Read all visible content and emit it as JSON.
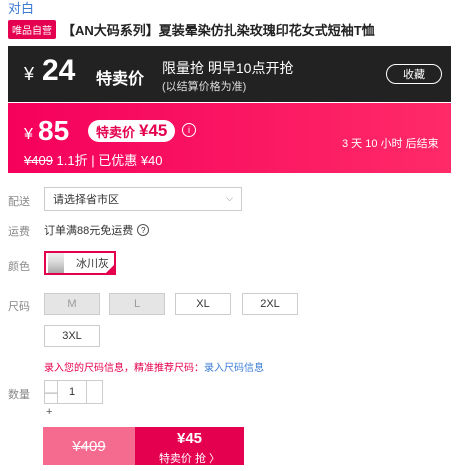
{
  "header": {
    "brand": "对白",
    "tag": "唯品自营",
    "title": "【AN大码系列】夏装晕染仿扎染玫瑰印花女式短袖T恤"
  },
  "flash_sale": {
    "currency": "¥",
    "price": "24",
    "label": "特卖价",
    "line1": "限量抢 明早10点开抢",
    "line2": "(以结算价格为准)",
    "favorite_label": "收藏"
  },
  "price": {
    "currency": "¥",
    "current": "85",
    "sale_label": "特卖价",
    "sale_amount": "¥45",
    "info_icon": "i",
    "original": "¥409",
    "discount_text": "1.1折 | 已优惠 ¥40",
    "countdown": "3 天 10 小时 后结束"
  },
  "shipping_to": {
    "label": "配送",
    "placeholder": "请选择省市区"
  },
  "freight": {
    "label": "运费",
    "text": "订单满88元免运费",
    "help_icon": "?"
  },
  "color": {
    "label": "颜色",
    "selected": "冰川灰"
  },
  "size": {
    "label": "尺码",
    "options": [
      {
        "name": "M",
        "available": false
      },
      {
        "name": "L",
        "available": false
      },
      {
        "name": "XL",
        "available": true
      },
      {
        "name": "2XL",
        "available": true
      },
      {
        "name": "3XL",
        "available": true
      }
    ],
    "hint": "录入您的尺码信息，精准推荐尺码：",
    "hint_link": "录入尺码信息"
  },
  "quantity": {
    "label": "数量",
    "value": "1",
    "minus": "—",
    "plus": "+"
  },
  "buy": {
    "original_price": "¥409",
    "sale_price": "¥45",
    "cta": "特卖价 抢 〉"
  },
  "colors": {
    "accent": "#e5004f",
    "link": "#3a7bd5",
    "dark_bar": "#222222"
  },
  "icons": {
    "info": "info-icon",
    "help": "help-circle-icon",
    "chevron": "chevron-down-icon",
    "check": "check-corner-icon"
  }
}
